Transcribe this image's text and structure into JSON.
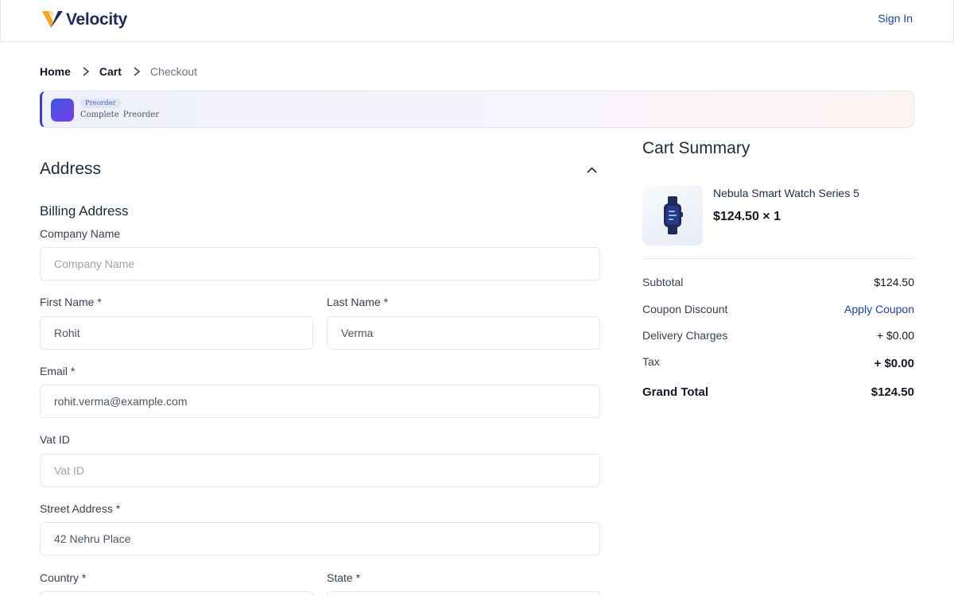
{
  "header": {
    "brand": "Velocity",
    "sign_in": "Sign In"
  },
  "breadcrumb": {
    "items": [
      "Home",
      "Cart"
    ],
    "current": "Checkout"
  },
  "preorder": {
    "badge": "Preorder",
    "text": "Complete  Preorder"
  },
  "address": {
    "title": "Address",
    "billing_title": "Billing Address",
    "fields": {
      "company": {
        "label": "Company Name",
        "placeholder": "Company Name",
        "value": ""
      },
      "first_name": {
        "label": "First Name *",
        "placeholder": "First Name",
        "value": "Rohit"
      },
      "last_name": {
        "label": "Last Name *",
        "placeholder": "Last Name",
        "value": "Verma"
      },
      "email": {
        "label": "Email *",
        "placeholder": "Email",
        "value": "rohit.verma@example.com"
      },
      "vat": {
        "label": "Vat ID",
        "placeholder": "Vat ID",
        "value": ""
      },
      "street": {
        "label": "Street Address *",
        "placeholder": "Street Address",
        "value": "42 Nehru Place"
      },
      "country": {
        "label": "Country *"
      },
      "state": {
        "label": "State *"
      }
    }
  },
  "cart": {
    "title": "Cart Summary",
    "product": {
      "name": "Nebula Smart Watch Series 5",
      "price_qty": "$124.50 × 1"
    },
    "summary": {
      "subtotal_label": "Subtotal",
      "subtotal_value": "$124.50",
      "coupon_label": "Coupon Discount",
      "coupon_action": "Apply Coupon",
      "delivery_label": "Delivery Charges",
      "delivery_value": "+ $0.00",
      "tax_label": "Tax",
      "tax_value": "+ $0.00",
      "grand_label": "Grand Total",
      "grand_value": "$124.50"
    }
  },
  "colors": {
    "brand_navy": "#1e2a5a",
    "link_blue": "#1e40af",
    "logo_orange": "#f5a623",
    "preorder_accent": "#4338ca"
  },
  "icons": [
    "velocity-logo-icon",
    "chevron-right-icon",
    "chevron-up-icon",
    "smartwatch-icon",
    "preorder-icon"
  ]
}
